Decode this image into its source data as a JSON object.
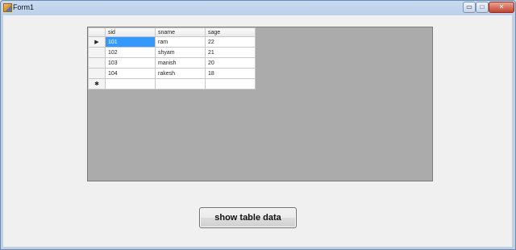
{
  "window": {
    "title": "Form1",
    "minimize_glyph": "▭",
    "maximize_glyph": "□",
    "close_glyph": "✕"
  },
  "grid": {
    "columns": [
      "sid",
      "sname",
      "sage"
    ],
    "rows": [
      {
        "sid": "101",
        "sname": "ram",
        "sage": "22"
      },
      {
        "sid": "102",
        "sname": "shyam",
        "sage": "21"
      },
      {
        "sid": "103",
        "sname": "manish",
        "sage": "20"
      },
      {
        "sid": "104",
        "sname": "rakesh",
        "sage": "18"
      }
    ],
    "current_row_glyph": "▶",
    "new_row_glyph": "✱"
  },
  "actions": {
    "show_label": "show table data"
  },
  "colors": {
    "selection": "#3399ff",
    "grid_background": "#ababab"
  }
}
